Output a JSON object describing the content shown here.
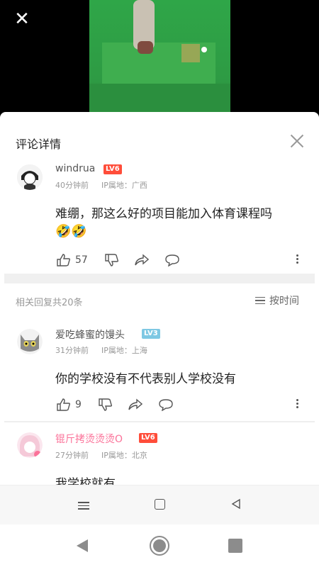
{
  "video": {
    "close_icon": "close-icon"
  },
  "sheet": {
    "title": "评论详情"
  },
  "main_comment": {
    "user": "windrua",
    "level": "LV6",
    "level_color": "#ff4d3a",
    "time": "40分钟前",
    "ip": "IP属地：广西",
    "text": "难绷，那这么好的项目能加入体育课程吗",
    "emoji": "🤣🤣",
    "likes": "57"
  },
  "replies": {
    "count_label": "相关回复共20条",
    "sort_label": "按时间",
    "items": [
      {
        "user": "爱吃蜂蜜的馒头",
        "level": "LV3",
        "level_color": "#7ec8e3",
        "time": "31分钟前",
        "ip": "IP属地：上海",
        "text": "你的学校没有不代表别人学校没有",
        "likes": "9"
      },
      {
        "user": "锟斤拷烫烫烫O",
        "level": "LV6",
        "level_color": "#ff4d3a",
        "name_color": "#fb7299",
        "time": "27分钟前",
        "ip": "IP属地：北京",
        "text": "我学校就有"
      }
    ]
  }
}
